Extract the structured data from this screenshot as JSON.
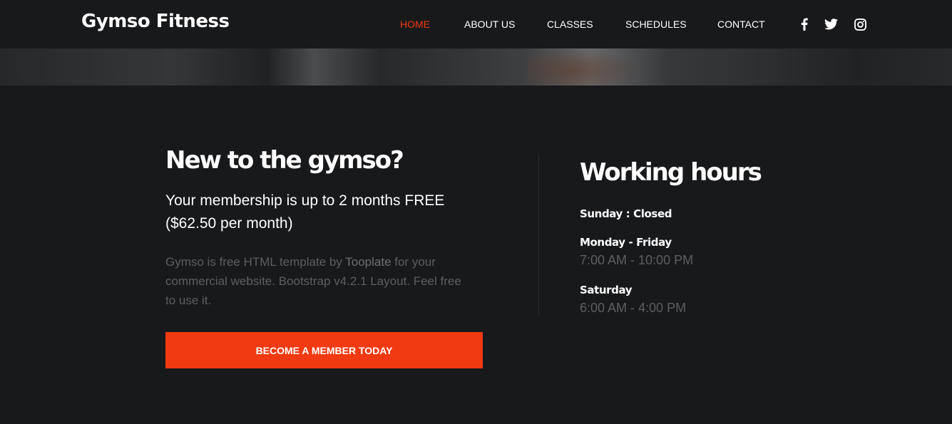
{
  "brand": {
    "name": "Gymso Fitness"
  },
  "nav": {
    "items": [
      {
        "label": "HOME",
        "active": true
      },
      {
        "label": "ABOUT US",
        "active": false
      },
      {
        "label": "CLASSES",
        "active": false
      },
      {
        "label": "SCHEDULES",
        "active": false
      },
      {
        "label": "CONTACT",
        "active": false
      }
    ],
    "social": [
      "facebook-icon",
      "twitter-icon",
      "instagram-icon"
    ]
  },
  "colors": {
    "accent": "#f13a11",
    "background": "#18191b",
    "muted_text": "#5d5e61"
  },
  "membership": {
    "heading": "New to the gymso?",
    "offer": "Your membership is up to 2 months FREE ($62.50 per month)",
    "desc_before": "Gymso is free HTML template by ",
    "desc_link": "Tooplate",
    "desc_after": " for your commercial website. Bootstrap v4.2.1 Layout. Feel free to use it.",
    "cta_label": "BECOME A MEMBER TODAY"
  },
  "hours": {
    "heading": "Working hours",
    "entries": [
      {
        "day": "Sunday : Closed",
        "time": ""
      },
      {
        "day": "Monday - Friday",
        "time": "7:00 AM - 10:00 PM"
      },
      {
        "day": "Saturday",
        "time": "6:00 AM - 4:00 PM"
      }
    ]
  }
}
